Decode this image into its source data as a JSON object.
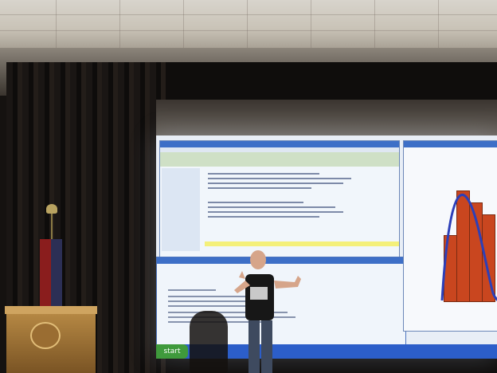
{
  "scene": {
    "description_elements": [
      "ceiling",
      "curtain",
      "projection-screen",
      "podium",
      "flag",
      "presenter",
      "shadow"
    ]
  },
  "screen": {
    "taskbar": {
      "start_label": "start"
    },
    "plot": {
      "bars": [
        0.55,
        0.92,
        0.82,
        0.72
      ]
    }
  }
}
